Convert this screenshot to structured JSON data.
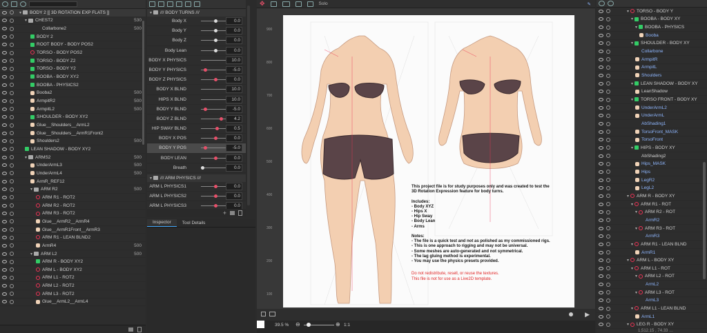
{
  "colors": {
    "accent_pink": "#e8506a",
    "warn_red": "#e02525",
    "link_blue": "#8fb7ff",
    "skin": "#f3cfb1",
    "cloth": "#5a4448"
  },
  "parts": {
    "root": "BODY 2 [[ 3D ROTATION EXP FLATS ]]",
    "items": [
      {
        "indent": 2,
        "kind": "folder",
        "label": "CHEST2",
        "num": "530",
        "arrow": "▾"
      },
      {
        "indent": 4,
        "kind": "none",
        "label": "Collarbone2",
        "num": "500"
      },
      {
        "indent": 3,
        "kind": "warp",
        "label": "BODY 2",
        "num": ""
      },
      {
        "indent": 3,
        "kind": "warp",
        "label": "ROOT BODY - BODY POS2",
        "num": ""
      },
      {
        "indent": 3,
        "kind": "rot",
        "label": "TORSO - BODY POS2",
        "num": ""
      },
      {
        "indent": 3,
        "kind": "warp",
        "label": "TORSO - BODY Z2",
        "num": ""
      },
      {
        "indent": 3,
        "kind": "warp",
        "label": "TORSO - BODY Y2",
        "num": ""
      },
      {
        "indent": 3,
        "kind": "warp",
        "label": "BOOBA - BODY XY2",
        "num": ""
      },
      {
        "indent": 3,
        "kind": "warp",
        "label": "BOOBA - PHYSICS2",
        "num": ""
      },
      {
        "indent": 3,
        "kind": "art",
        "label": "Booba2",
        "num": "500"
      },
      {
        "indent": 3,
        "kind": "art",
        "label": "ArmpitR2",
        "num": "500"
      },
      {
        "indent": 3,
        "kind": "art",
        "label": "ArmpitL2",
        "num": "500"
      },
      {
        "indent": 3,
        "kind": "warp",
        "label": "SHOULDER - BODY XY2",
        "num": ""
      },
      {
        "indent": 3,
        "kind": "art",
        "label": "Glue__Shoulders__ArmL2",
        "num": ""
      },
      {
        "indent": 3,
        "kind": "art",
        "label": "Glue__Shoulders__ArmR1Front2",
        "num": ""
      },
      {
        "indent": 3,
        "kind": "art",
        "label": "Shoulders2",
        "num": "500"
      },
      {
        "indent": 2,
        "kind": "warp",
        "label": "LEAN SHADOW - BODY XY2",
        "num": ""
      },
      {
        "indent": 2,
        "kind": "folder",
        "label": "ARMS2",
        "num": "500",
        "arrow": "▾"
      },
      {
        "indent": 3,
        "kind": "art",
        "label": "UnderArmL3",
        "num": "500"
      },
      {
        "indent": 3,
        "kind": "art",
        "label": "UnderArmL4",
        "num": "500"
      },
      {
        "indent": 3,
        "kind": "art",
        "label": "ArmR_REF12",
        "num": ""
      },
      {
        "indent": 3,
        "kind": "folder",
        "label": "ARM R2",
        "num": "500",
        "arrow": "▾"
      },
      {
        "indent": 4,
        "kind": "rot",
        "label": "ARM R1 - ROT2",
        "num": ""
      },
      {
        "indent": 4,
        "kind": "rot",
        "label": "ARM R2 - ROT2",
        "num": ""
      },
      {
        "indent": 4,
        "kind": "rot",
        "label": "ARM R3 - ROT2",
        "num": ""
      },
      {
        "indent": 4,
        "kind": "art",
        "label": "Glue__ArmR2__ArmR4",
        "num": ""
      },
      {
        "indent": 4,
        "kind": "art",
        "label": "Glue__ArmR1Front__ArmR3",
        "num": ""
      },
      {
        "indent": 4,
        "kind": "rot",
        "label": "ARM R1 - LEAN BLND2",
        "num": ""
      },
      {
        "indent": 4,
        "kind": "art",
        "label": "ArmR4",
        "num": "500"
      },
      {
        "indent": 3,
        "kind": "folder",
        "label": "ARM L2",
        "num": "500",
        "arrow": "▾"
      },
      {
        "indent": 4,
        "kind": "warp",
        "label": "ARM R - BODY XY2",
        "num": ""
      },
      {
        "indent": 4,
        "kind": "rot",
        "label": "ARM L - BODY XY2",
        "num": ""
      },
      {
        "indent": 4,
        "kind": "rot",
        "label": "ARM L1 - ROT2",
        "num": ""
      },
      {
        "indent": 4,
        "kind": "rot",
        "label": "ARM L2 - ROT2",
        "num": ""
      },
      {
        "indent": 4,
        "kind": "rot",
        "label": "ARM L3 - ROT2",
        "num": ""
      },
      {
        "indent": 4,
        "kind": "art",
        "label": "Glue__ArmL2__ArmL4",
        "num": ""
      }
    ]
  },
  "params": {
    "group1": "/// BODY TURNS ///",
    "rows": [
      {
        "name": "Body X",
        "value": "0.0",
        "knob": 0.5,
        "pink": false,
        "sel": false
      },
      {
        "name": "Body Y",
        "value": "0.0",
        "knob": 0.5,
        "pink": false,
        "sel": false
      },
      {
        "name": "Body Z",
        "value": "0.0",
        "knob": 0.5,
        "pink": false,
        "sel": false
      },
      {
        "name": "Body Lean",
        "value": "0.0",
        "knob": 0.5,
        "pink": false,
        "sel": false
      },
      {
        "name": "BODY X PHYSICS",
        "value": "10.0",
        "knob": 1.0,
        "pink": true,
        "sel": false
      },
      {
        "name": "BODY Y PHYSICS",
        "value": "-5.0",
        "knob": 0.1,
        "pink": true,
        "sel": false
      },
      {
        "name": "BODY Z PHYSICS",
        "value": "0.0",
        "knob": 0.5,
        "pink": true,
        "sel": false
      },
      {
        "name": "BODY X BLND",
        "value": "10.0",
        "knob": 1.0,
        "pink": true,
        "sel": false
      },
      {
        "name": "HIPS X BLND",
        "value": "10.0",
        "knob": 1.0,
        "pink": true,
        "sel": false
      },
      {
        "name": "BODY Y BLND",
        "value": "-5.0",
        "knob": 0.1,
        "pink": true,
        "sel": false
      },
      {
        "name": "BODY Z BLND",
        "value": "4.2",
        "knob": 0.7,
        "pink": true,
        "sel": false
      },
      {
        "name": "HIP SWAY BLND",
        "value": "0.5",
        "knob": 0.55,
        "pink": true,
        "sel": false
      },
      {
        "name": "BODY X POS",
        "value": "0.0",
        "knob": 0.5,
        "pink": true,
        "sel": false
      },
      {
        "name": "BODY Y POS",
        "value": "-5.0",
        "knob": 0.1,
        "pink": true,
        "sel": true
      },
      {
        "name": "BODY LEAN",
        "value": "0.0",
        "knob": 0.5,
        "pink": true,
        "sel": false
      },
      {
        "name": "Breath",
        "value": "0.0",
        "knob": 0.0,
        "pink": false,
        "sel": false
      }
    ],
    "group2": "/// ARM PHYSICS ///",
    "rows2": [
      {
        "name": "ARM L PHYSICS1",
        "value": "0.0",
        "knob": 0.5,
        "pink": true,
        "sel": false
      },
      {
        "name": "ARM L PHYSICS2",
        "value": "0.0",
        "knob": 0.5,
        "pink": true,
        "sel": false
      },
      {
        "name": "ARM L PHYSICS3",
        "value": "0.0",
        "knob": 0.5,
        "pink": true,
        "sel": false
      }
    ]
  },
  "inspector": {
    "tab1": "Inspector",
    "tab2": "Tool Details"
  },
  "canvas": {
    "solo": "Solo",
    "ruler": [
      "900",
      "800",
      "700",
      "600",
      "500",
      "400",
      "300",
      "200",
      "100"
    ],
    "zoom": "39.5 %",
    "ratio": "1:1",
    "notes": [
      "This project file is for study purposes only and was created to test the",
      "3D Rotation Expression feature for body turns.",
      "",
      "Includes:",
      "  - Body XYZ",
      "  - Hips X",
      "  - Hip Sway",
      "  - Body Lean",
      "  - Arms",
      "",
      "Notes:",
      "  - The file is a quick test and not as polished as my commissioned rigs.",
      "  - This is one approach to rigging and may not be universal.",
      "  - Some meshes are auto-generated and not symmetrical.",
      "  - The lag gluing method is experimental.",
      "  - You may use the physics presets provided."
    ],
    "warnings": [
      "Do not redistribute, resell, or reuse the textures.",
      "This file is not for use as a Live2D template."
    ],
    "status": "1,512.15 , 74.33 …"
  },
  "right_tree": [
    {
      "indent": 4,
      "kind": "rot",
      "label": "TORSO - BODY Y",
      "blue": false,
      "arrow": "▾"
    },
    {
      "indent": 5,
      "kind": "warp",
      "label": "BOOBA - BODY XY",
      "blue": false,
      "arrow": "▾"
    },
    {
      "indent": 6,
      "kind": "warp",
      "label": "BOOBA - PHYSICS",
      "blue": false,
      "arrow": "▾"
    },
    {
      "indent": 7,
      "kind": "art",
      "label": "Booba",
      "blue": true,
      "arrow": ""
    },
    {
      "indent": 5,
      "kind": "warp",
      "label": "SHOULDER - BODY XY",
      "blue": false,
      "arrow": "▾"
    },
    {
      "indent": 6,
      "kind": "none",
      "label": "Collarbone",
      "blue": true,
      "arrow": ""
    },
    {
      "indent": 6,
      "kind": "art",
      "label": "ArmpitR",
      "blue": true,
      "arrow": ""
    },
    {
      "indent": 6,
      "kind": "art",
      "label": "ArmpitL",
      "blue": true,
      "arrow": ""
    },
    {
      "indent": 6,
      "kind": "art",
      "label": "Shoulders",
      "blue": true,
      "arrow": ""
    },
    {
      "indent": 5,
      "kind": "warp",
      "label": "LEAN SHADOW - BODY XY",
      "blue": false,
      "arrow": "▾"
    },
    {
      "indent": 6,
      "kind": "art",
      "label": "LeanShadow",
      "blue": false,
      "arrow": ""
    },
    {
      "indent": 5,
      "kind": "warp",
      "label": "TORSO FRONT - BODY XY",
      "blue": false,
      "arrow": "▾"
    },
    {
      "indent": 6,
      "kind": "art",
      "label": "UnderArmL2",
      "blue": true,
      "arrow": ""
    },
    {
      "indent": 6,
      "kind": "art",
      "label": "UnderArmL",
      "blue": true,
      "arrow": ""
    },
    {
      "indent": 6,
      "kind": "none",
      "label": "AbShading1",
      "blue": true,
      "arrow": ""
    },
    {
      "indent": 6,
      "kind": "art",
      "label": "TorsoFront_MASK",
      "blue": true,
      "arrow": ""
    },
    {
      "indent": 6,
      "kind": "art",
      "label": "TorsoFront",
      "blue": true,
      "arrow": ""
    },
    {
      "indent": 5,
      "kind": "warp",
      "label": "HIPS - BODY XY",
      "blue": false,
      "arrow": "▾"
    },
    {
      "indent": 6,
      "kind": "none",
      "label": "AbShading2",
      "blue": false,
      "arrow": ""
    },
    {
      "indent": 6,
      "kind": "art",
      "label": "Hips_MASK",
      "blue": true,
      "arrow": ""
    },
    {
      "indent": 6,
      "kind": "art",
      "label": "Hips",
      "blue": true,
      "arrow": ""
    },
    {
      "indent": 6,
      "kind": "art",
      "label": "LegR2",
      "blue": true,
      "arrow": ""
    },
    {
      "indent": 6,
      "kind": "art",
      "label": "LegL2",
      "blue": true,
      "arrow": ""
    },
    {
      "indent": 4,
      "kind": "rot",
      "label": "ARM R - BODY XY",
      "blue": false,
      "arrow": "▾"
    },
    {
      "indent": 5,
      "kind": "rot",
      "label": "ARM R1 - ROT",
      "blue": false,
      "arrow": "▾"
    },
    {
      "indent": 6,
      "kind": "rot",
      "label": "ARM R2 - ROT",
      "blue": false,
      "arrow": "▾"
    },
    {
      "indent": 7,
      "kind": "none",
      "label": "ArmR2",
      "blue": true,
      "arrow": ""
    },
    {
      "indent": 6,
      "kind": "rot",
      "label": "ARM R3 - ROT",
      "blue": false,
      "arrow": "▾"
    },
    {
      "indent": 7,
      "kind": "none",
      "label": "ArmR3",
      "blue": true,
      "arrow": ""
    },
    {
      "indent": 5,
      "kind": "rot",
      "label": "ARM R1 - LEAN BLND",
      "blue": false,
      "arrow": "▾"
    },
    {
      "indent": 6,
      "kind": "art",
      "label": "ArmR1",
      "blue": true,
      "arrow": ""
    },
    {
      "indent": 4,
      "kind": "rot",
      "label": "ARM L - BODY XY",
      "blue": false,
      "arrow": "▾"
    },
    {
      "indent": 5,
      "kind": "rot",
      "label": "ARM L1 - ROT",
      "blue": false,
      "arrow": "▾"
    },
    {
      "indent": 6,
      "kind": "rot",
      "label": "ARM L2 - ROT",
      "blue": false,
      "arrow": "▾"
    },
    {
      "indent": 7,
      "kind": "none",
      "label": "ArmL2",
      "blue": true,
      "arrow": ""
    },
    {
      "indent": 6,
      "kind": "rot",
      "label": "ARM L3 - ROT",
      "blue": false,
      "arrow": "▾"
    },
    {
      "indent": 7,
      "kind": "none",
      "label": "ArmL3",
      "blue": true,
      "arrow": ""
    },
    {
      "indent": 5,
      "kind": "rot",
      "label": "ARM L1 - LEAN BLND",
      "blue": false,
      "arrow": "▾"
    },
    {
      "indent": 6,
      "kind": "art",
      "label": "ArmL1",
      "blue": true,
      "arrow": ""
    },
    {
      "indent": 4,
      "kind": "rot",
      "label": "LEG R - BODY XY",
      "blue": false,
      "arrow": "▾"
    }
  ]
}
